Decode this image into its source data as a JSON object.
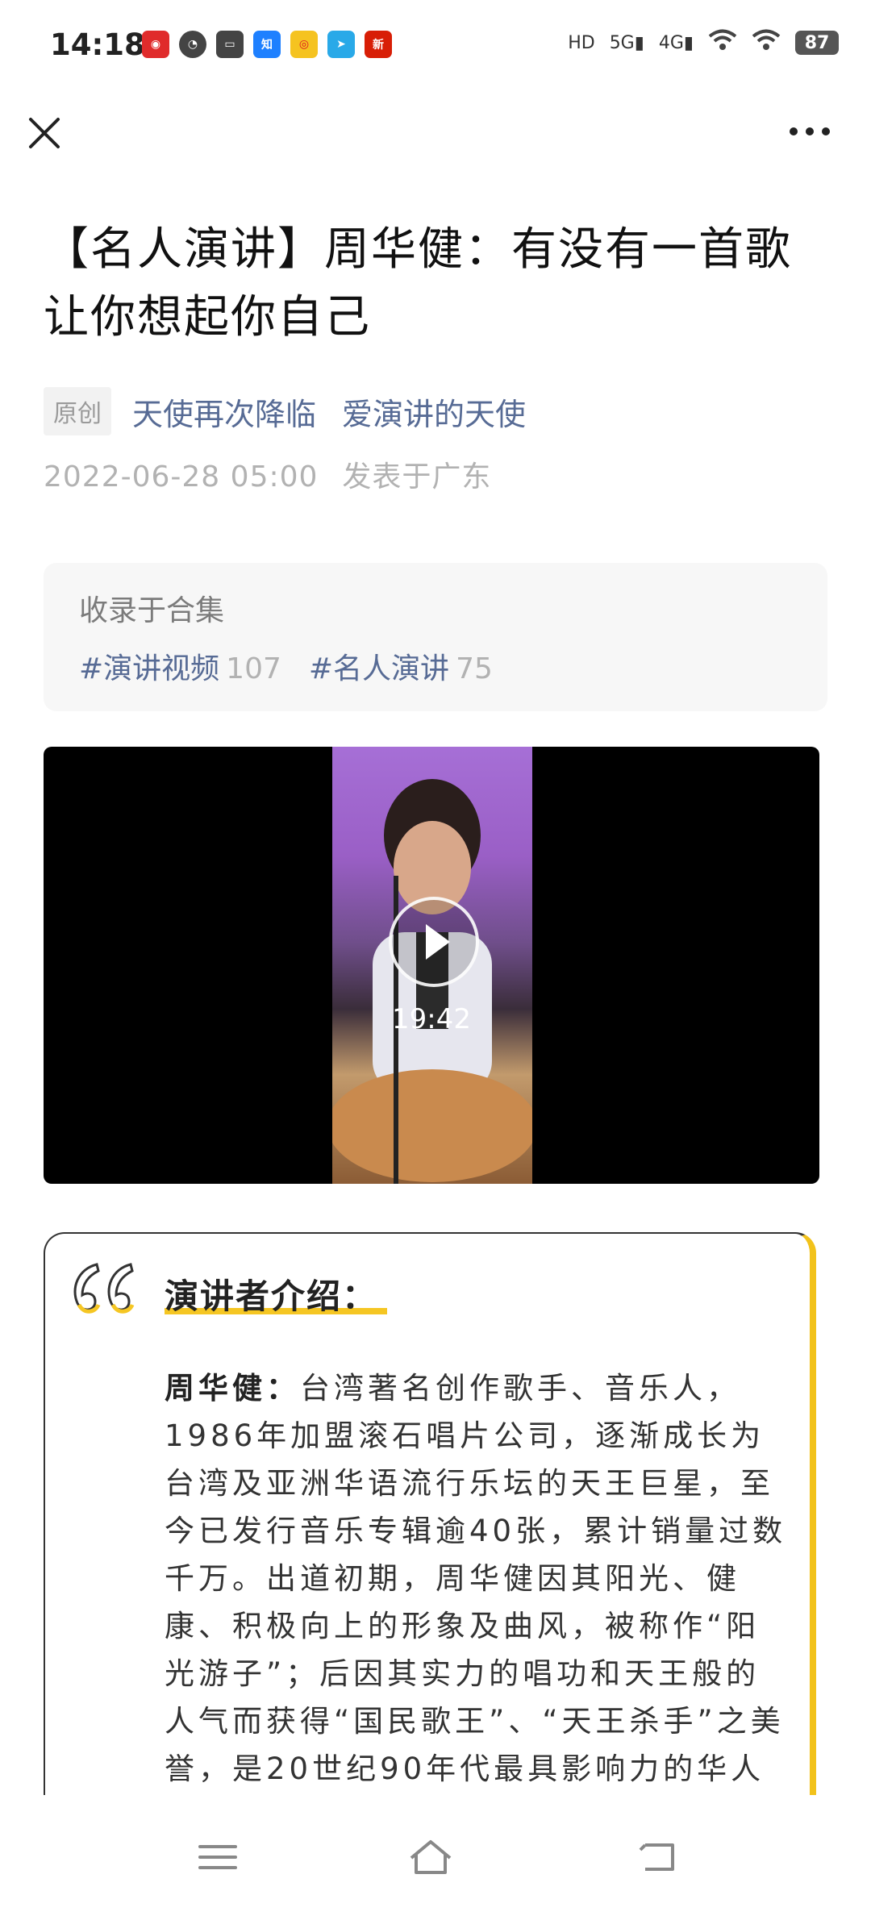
{
  "status_bar": {
    "time": "14:18",
    "network_labels": [
      "HD",
      "5G",
      "4G"
    ],
    "battery": "87",
    "app_icons": [
      "cat-app-icon",
      "speed-icon",
      "message-icon",
      "zhihu-icon",
      "weibo-icon",
      "telegram-icon",
      "news-icon"
    ]
  },
  "toolbar": {
    "close_icon": "close-icon",
    "more_icon": "more-icon"
  },
  "article": {
    "title": "【名人演讲】周华健：有没有一首歌让你想起你自己",
    "original_badge": "原创",
    "author_primary": "天使再次降临",
    "author_secondary": "爱演讲的天使",
    "date": "2022-06-28 05:00",
    "location": "发表于广东"
  },
  "collection": {
    "title": "收录于合集",
    "tags": [
      {
        "label": "#演讲视频",
        "count": "107"
      },
      {
        "label": "#名人演讲",
        "count": "75"
      }
    ]
  },
  "video": {
    "duration": "19:42"
  },
  "intro": {
    "heading": "演讲者介绍：",
    "name": "周华健：",
    "body": "台湾著名创作歌手、音乐人，1986年加盟滚石唱片公司，逐渐成长为台湾及亚洲华语流行乐坛的天王巨星，至今已发行音乐专辑逾40张，累计销量过数千万。出道初期，周华健因其阳光、健康、积极向上的形象及曲风，被称作“阳光游子”；后因其实力的唱功和天王般的人气而获得“国民歌王”、“天王杀手”之美誉，是20世纪90年代最具影响力的华人歌",
    "accent_color": "#f2c21b"
  },
  "nav_bar": {
    "icons": [
      "menu-icon",
      "home-icon",
      "back-icon"
    ]
  }
}
